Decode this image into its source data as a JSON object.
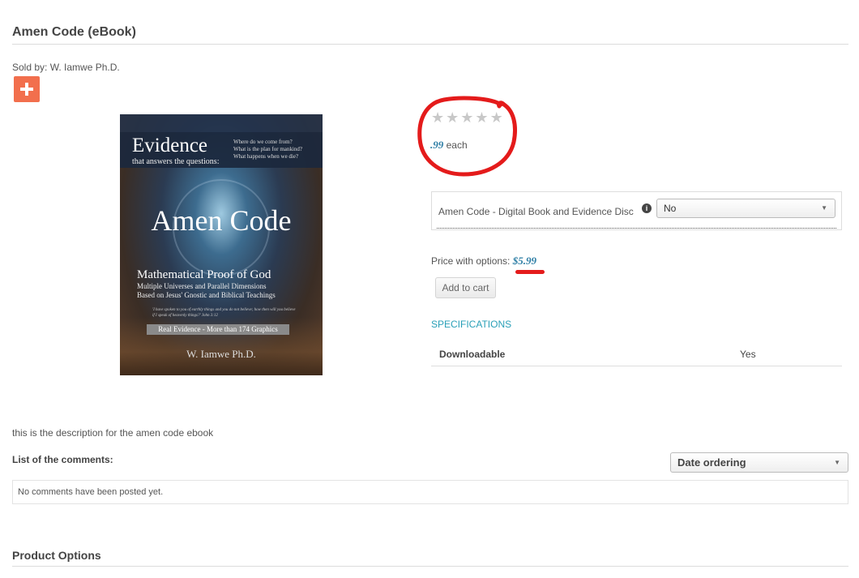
{
  "product": {
    "title": "Amen Code (eBook)",
    "sold_by": "Sold by: W. Iamwe Ph.D.",
    "add_icon": "plus-icon",
    "accent_color": "#f26f4d"
  },
  "cover": {
    "evidence": "Evidence",
    "subtitle": "that answers the questions:",
    "questions": [
      "Where do we come from?",
      "What is the plan for mankind?",
      "What happens when we die?"
    ],
    "title": "Amen Code",
    "proof": "Mathematical Proof of God",
    "line1": "Multiple Universes and Parallel Dimensions",
    "line2": "Based on Jesus' Gnostic and Biblical Teachings",
    "quote": "'I have spoken to you of earthly things and you do not believe; how then will you believe if I speak of heavenly things?' John 3:12",
    "badge": "Real Evidence - More than 174 Graphics",
    "author": "W. Iamwe Ph.D."
  },
  "rating": {
    "value": 0,
    "max": 5
  },
  "price": {
    "unit_amount": ".99",
    "unit_suffix": "each",
    "with_options_label": "Price with options:",
    "with_options_amount": "$5.99",
    "price_color": "#2f7fa6"
  },
  "options": {
    "label": "Amen Code - Digital Book and Evidence Disc",
    "selected": "No"
  },
  "actions": {
    "add_to_cart": "Add to cart"
  },
  "specifications": {
    "heading": "SPECIFICATIONS",
    "rows": [
      {
        "key": "Downloadable",
        "value": "Yes"
      }
    ]
  },
  "description": "this is the description for the amen code ebook",
  "comments": {
    "heading": "List of the comments:",
    "ordering": "Date ordering",
    "empty": "No comments have been posted yet."
  },
  "product_options": {
    "heading": "Product Options"
  },
  "annotations": {
    "color": "#e41b1b"
  }
}
